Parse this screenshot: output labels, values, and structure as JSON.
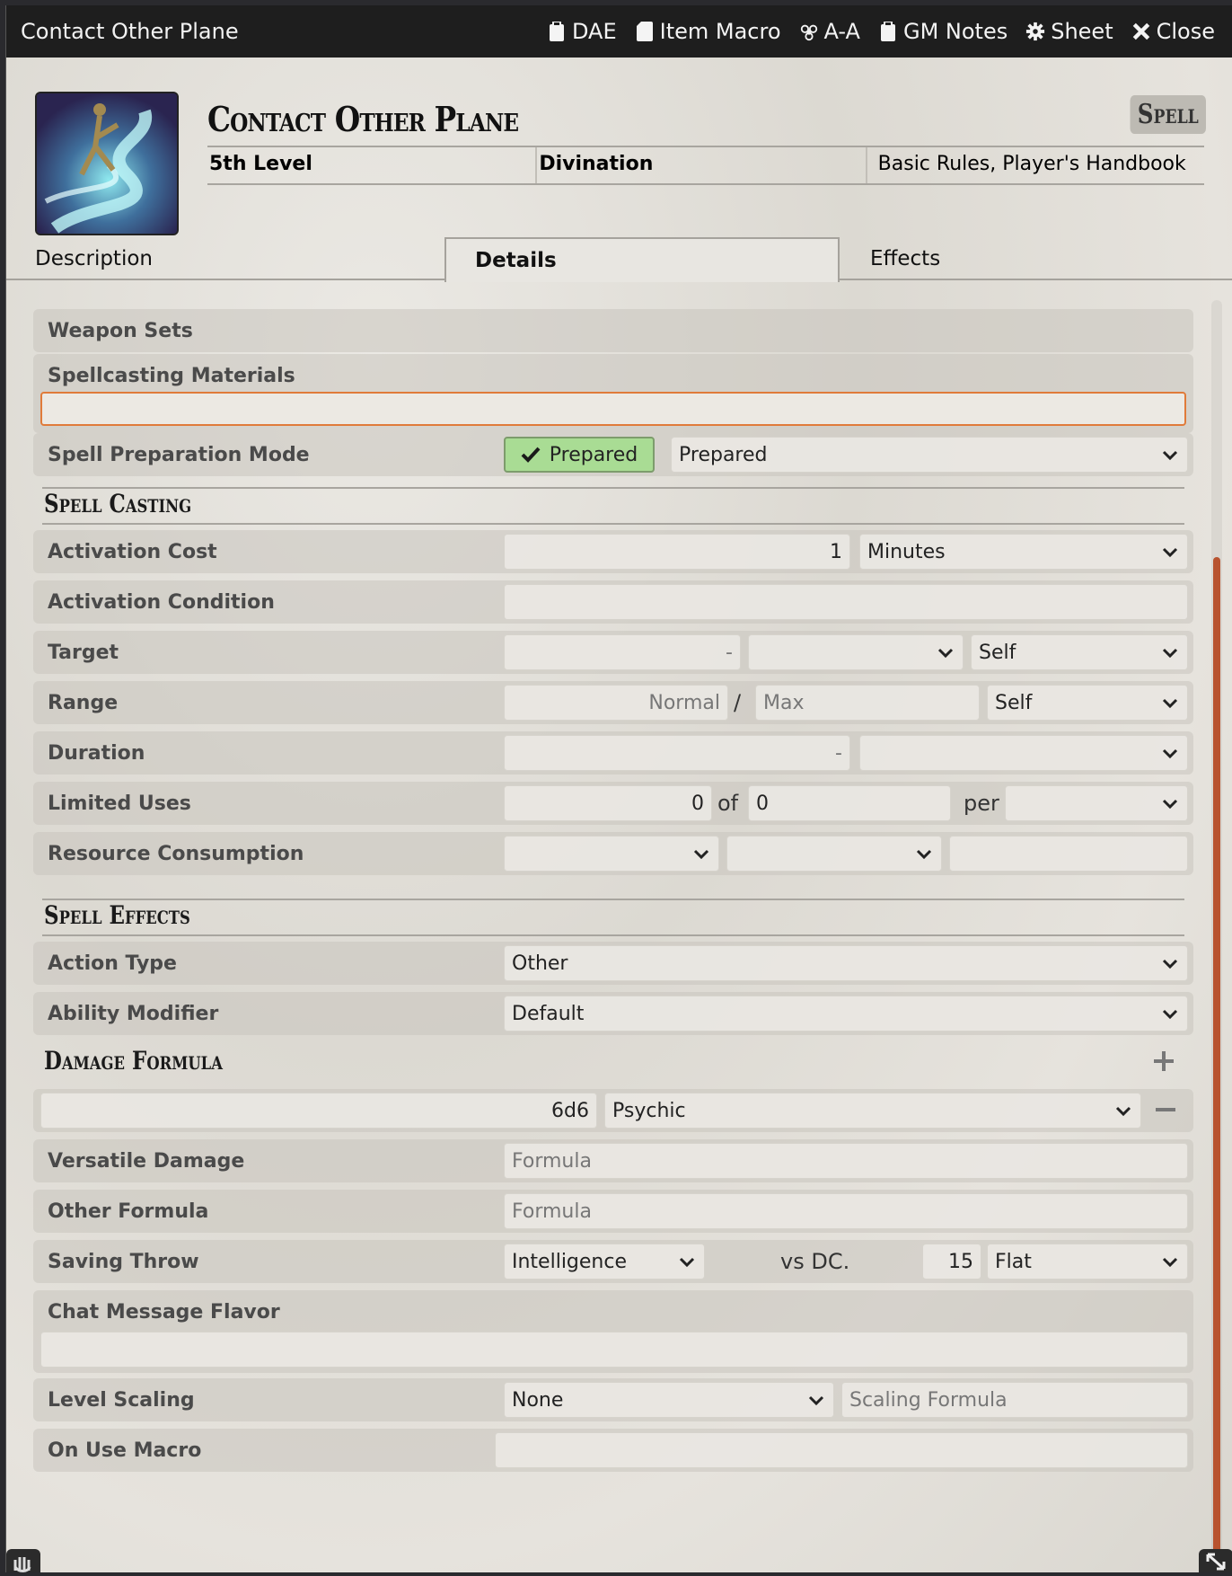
{
  "window": {
    "title": "Contact Other Plane"
  },
  "header_buttons": [
    {
      "label": "DAE",
      "icon": "clipboard-icon"
    },
    {
      "label": "Item Macro",
      "icon": "sd-card-icon"
    },
    {
      "label": "A-A",
      "icon": "biohazard-icon"
    },
    {
      "label": "GM Notes",
      "icon": "clipboard-icon"
    },
    {
      "label": "Sheet",
      "icon": "gear-icon"
    },
    {
      "label": "Close",
      "icon": "close-icon"
    }
  ],
  "item": {
    "name": "Contact Other Plane",
    "type": "Spell",
    "level": "5th Level",
    "school": "Divination",
    "source": "Basic Rules, Player's Handbook"
  },
  "tabs": [
    "Description",
    "Details",
    "Effects"
  ],
  "active_tab": "Details",
  "details": {
    "weapon_sets": "Weapon Sets",
    "materials_label": "Spellcasting Materials",
    "materials_value": "",
    "prep_label": "Spell Preparation Mode",
    "prep_badge": "Prepared",
    "prep_value": "Prepared",
    "casting_heading": "Spell Casting",
    "activation_cost_label": "Activation Cost",
    "activation_cost_value": "1",
    "activation_cost_unit": "Minutes",
    "activation_condition_label": "Activation Condition",
    "target_label": "Target",
    "target_value": "-",
    "target_type": "Self",
    "range_label": "Range",
    "range_normal": "Normal",
    "range_sep": "/",
    "range_max": "Max",
    "range_unit": "Self",
    "duration_label": "Duration",
    "duration_value": "-",
    "uses_label": "Limited Uses",
    "uses_value": "0",
    "uses_of": "of",
    "uses_max": "0",
    "uses_per": "per",
    "resource_label": "Resource Consumption",
    "effects_heading": "Spell Effects",
    "action_type_label": "Action Type",
    "action_type_value": "Other",
    "ability_label": "Ability Modifier",
    "ability_value": "Default",
    "damage_heading": "Damage Formula",
    "damage_formula": "6d6",
    "damage_type": "Psychic",
    "versatile_label": "Versatile Damage",
    "versatile_placeholder": "Formula",
    "other_label": "Other Formula",
    "other_placeholder": "Formula",
    "save_label": "Saving Throw",
    "save_ability": "Intelligence",
    "save_vs": "vs DC.",
    "save_dc": "15",
    "save_scaling": "Flat",
    "chat_label": "Chat Message Flavor",
    "scaling_label": "Level Scaling",
    "scaling_mode": "None",
    "scaling_placeholder": "Scaling Formula",
    "macro_label": "On Use Macro"
  },
  "colors": {
    "accent": "#e07b3a",
    "prepared_badge": "#a9dc94",
    "scrollbar": "#b8532f"
  }
}
